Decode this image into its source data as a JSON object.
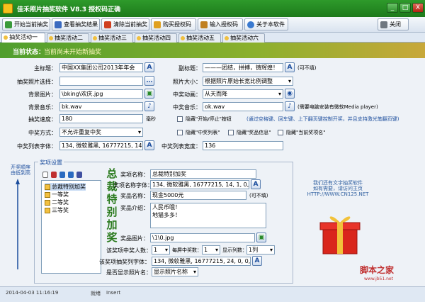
{
  "window": {
    "title": "佳禾照片抽奖软件 V8.3 授权码正确",
    "min": "_",
    "max": "□",
    "close": "X"
  },
  "toolbar": {
    "start": "开始当前抽奖",
    "view": "查看抽奖结果",
    "clear": "清除当前抽奖",
    "buy": "购买授权码",
    "enter": "输入授权码",
    "about": "关于本软件",
    "close": "关闭"
  },
  "tabs": [
    "抽奖活动一",
    "抽奖活动二",
    "抽奖活动三",
    "抽奖活动四",
    "抽奖活动五",
    "抽奖活动六"
  ],
  "status": {
    "label": "当前状态：",
    "value": "当前尚未开始新抽奖"
  },
  "form": {
    "main_title_label": "主标题：",
    "main_title_value": "中国XX集团公司2013年年会",
    "sub_title_label": "副标题：",
    "sub_title_value": "———团结，拼搏，铸辉煌！",
    "sub_title_note": "(可不填)",
    "photo_select_label": "抽奖照片选择：",
    "photo_size_label": "照片大小：",
    "photo_size_value": "根据照片原始长宽比例调整",
    "bg_image_label": "背景图片：",
    "bg_image_value": "\\bking\\欢庆.jpg",
    "win_anim_label": "中奖动画：",
    "win_anim_value": "从天而降",
    "bg_music_label": "背景音乐：",
    "bg_music_value": "bk.wav",
    "win_music_label": "中奖音乐：",
    "win_music_value": "ok.wav",
    "win_music_note": "(需要电脑安装有微软Media player)",
    "speed_label": "抽奖速度：",
    "speed_value": "180",
    "speed_unit": "毫秒",
    "hide_start_label": "隐藏\"开始/停止\"按钮",
    "hide_start_note": "(通过空格键、回车键、上下翻页键控制开奖，并且支持激光笔翻页键)",
    "win_mode_label": "中奖方式：",
    "win_mode_value": "不允许重复中奖",
    "hide_list_label": "隐藏\"中奖列表\"",
    "hide_info_label": "隐藏\"奖品信息\"",
    "hide_name_label": "隐藏\"当前奖项名\"",
    "font_label": "中奖列表字体：",
    "font_value": "134, 微软雅黑, 16777215, 14, 1, 0, 0, 0",
    "list_width_label": "中奖列表宽度：",
    "list_width_value": "136"
  },
  "prize": {
    "group_title": "奖项设置",
    "order_label": "开奖顺序由低到高",
    "tree": [
      "总裁特别加奖",
      "一等奖",
      "二等奖",
      "三等奖"
    ],
    "big_text": "总裁特别加奖",
    "name_label": "奖项名称：",
    "name_value": "总裁特别加奖",
    "font_label": "奖项名称字体：",
    "font_value": "134, 微软雅黑, 16777215, 14, 1, 0, 0, 0",
    "prize_name_label": "奖品名称：",
    "prize_name_value": "现金5000元",
    "prize_name_note": "(可不填)",
    "intro_label": "奖品介绍：",
    "intro_line1": "人民币哦！",
    "intro_line2": "地猫多多！",
    "image_label": "奖品图片：",
    "image_value": "\\1\\0.jpg",
    "count_label": "该奖项中奖人数：",
    "count_value": "1",
    "per_label": "每屏中奖数：",
    "per_value": "1",
    "cols_label": "显示列数：",
    "cols_value": "1列",
    "list_font_label": "该奖项抽奖列字体：",
    "list_font_value": "134, 微软雅黑, 16777215, 24, 0, 0, 0, 0",
    "show_photo_label": "是否显示照片名：",
    "show_photo_value": "显示照片名称"
  },
  "ad": {
    "line1": "我们还有文字抽奖软件",
    "line2": "如有需要，请访问主页",
    "line3": "HTTP://WWW.CN125.NET"
  },
  "footer": {
    "datetime": "2014-04-03 11:16:19",
    "mode1": "就绪",
    "mode2": "Insert"
  },
  "logo": {
    "text": "脚本之家",
    "url": "www.jb51.net"
  },
  "colors": {
    "titlebar": "#1d7a1b",
    "status": "#4f9e2d",
    "accent": "#1a4c9c"
  }
}
